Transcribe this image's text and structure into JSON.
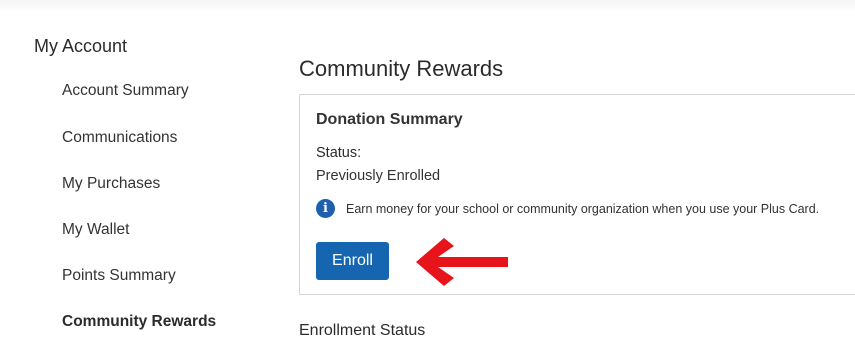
{
  "sidebar": {
    "title": "My Account",
    "items": [
      {
        "label": "Account Summary"
      },
      {
        "label": "Communications"
      },
      {
        "label": "My Purchases"
      },
      {
        "label": "My Wallet"
      },
      {
        "label": "Points Summary"
      },
      {
        "label": "Community Rewards"
      }
    ],
    "active_item": "Community Rewards"
  },
  "main": {
    "title": "Community Rewards",
    "card": {
      "title": "Donation Summary",
      "status_label": "Status:",
      "status_value": "Previously Enrolled",
      "info_icon": "info-circle-icon",
      "info_text": "Earn money for your school or community organization when you use your Plus Card.",
      "enroll_label": "Enroll"
    },
    "next_section_title": "Enrollment Status"
  },
  "colors": {
    "primary_button": "#1565b0",
    "info_icon": "#1e5fae",
    "annotation_arrow": "#e8141c"
  }
}
